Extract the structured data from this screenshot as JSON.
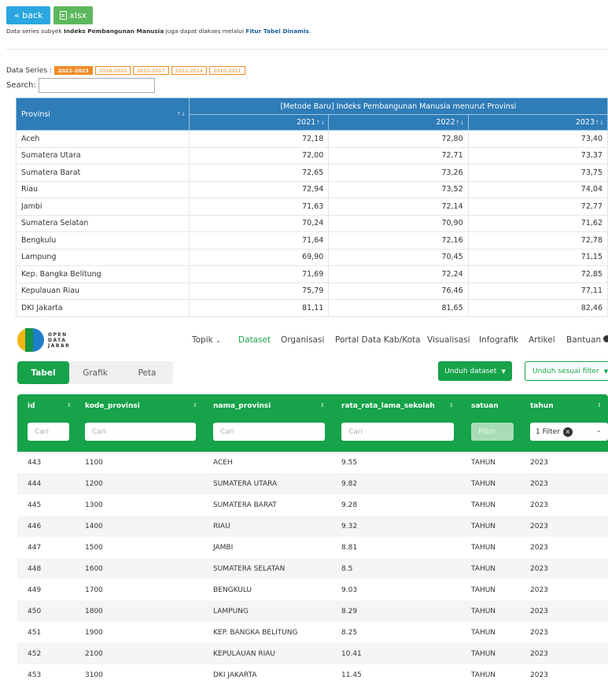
{
  "header": {
    "back_label": "« back",
    "xlsx_label": "xlsx",
    "desc_prefix": "Data series subyek ",
    "desc_subject": "Indeks Pembangunan Manusia",
    "desc_middle": " juga dapat diakses melalui ",
    "desc_link": "Fitur Tabel Dinamis",
    "desc_suffix": "."
  },
  "series": {
    "label": "Data Series :",
    "options": [
      "2021-2023",
      "2018-2020",
      "2015-2017",
      "2012-2014",
      "2010-2011"
    ],
    "active": "2021-2023"
  },
  "search": {
    "label": "Search:",
    "value": ""
  },
  "ipm_table": {
    "col_provinsi": "Provinsi",
    "group_header": "[Metode Baru] Indeks Pembangunan Manusia menurut Provinsi",
    "years": [
      "2021",
      "2022",
      "2023"
    ],
    "rows": [
      {
        "prov": "Aceh",
        "v": [
          "72,18",
          "72,80",
          "73,40"
        ]
      },
      {
        "prov": "Sumatera Utara",
        "v": [
          "72,00",
          "72,71",
          "73,37"
        ]
      },
      {
        "prov": "Sumatera Barat",
        "v": [
          "72,65",
          "73,26",
          "73,75"
        ]
      },
      {
        "prov": "Riau",
        "v": [
          "72,94",
          "73,52",
          "74,04"
        ]
      },
      {
        "prov": "Jambi",
        "v": [
          "71,63",
          "72,14",
          "72,77"
        ]
      },
      {
        "prov": "Sumatera Selatan",
        "v": [
          "70,24",
          "70,90",
          "71,62"
        ]
      },
      {
        "prov": "Bengkulu",
        "v": [
          "71,64",
          "72,16",
          "72,78"
        ]
      },
      {
        "prov": "Lampung",
        "v": [
          "69,90",
          "70,45",
          "71,15"
        ]
      },
      {
        "prov": "Kep. Bangka Belitung",
        "v": [
          "71,69",
          "72,24",
          "72,85"
        ]
      },
      {
        "prov": "Kepulauan Riau",
        "v": [
          "75,79",
          "76,46",
          "77,11"
        ]
      },
      {
        "prov": "DKI Jakarta",
        "v": [
          "81,11",
          "81,65",
          "82,46"
        ]
      }
    ]
  },
  "odj": {
    "logo_lines": [
      "OPEN",
      "DATA",
      "JABAR"
    ],
    "nav": [
      "Topik",
      "Dataset",
      "Organisasi",
      "Portal Data Kab/Kota",
      "Visualisasi",
      "Infografik",
      "Artikel",
      "Bantuan"
    ],
    "nav_active": "Dataset",
    "tabs": [
      "Tabel",
      "Grafik",
      "Peta"
    ],
    "tab_active": "Tabel",
    "btn_unduh": "Unduh dataset",
    "btn_unduh_filter": "Unduh sesuai filter",
    "columns": [
      "id",
      "kode_provinsi",
      "nama_provinsi",
      "rata_rata_lama_sekolah",
      "satuan",
      "tahun"
    ],
    "filter_placeholder": "Cari",
    "filter_satuan_placeholder": "Filter",
    "filter_tahun_value": "1 Filter",
    "rows": [
      [
        "443",
        "1100",
        "ACEH",
        "9.55",
        "TAHUN",
        "2023"
      ],
      [
        "444",
        "1200",
        "SUMATERA UTARA",
        "9.82",
        "TAHUN",
        "2023"
      ],
      [
        "445",
        "1300",
        "SUMATERA BARAT",
        "9.28",
        "TAHUN",
        "2023"
      ],
      [
        "446",
        "1400",
        "RIAU",
        "9.32",
        "TAHUN",
        "2023"
      ],
      [
        "447",
        "1500",
        "JAMBI",
        "8.81",
        "TAHUN",
        "2023"
      ],
      [
        "448",
        "1600",
        "SUMATERA SELATAN",
        "8.5",
        "TAHUN",
        "2023"
      ],
      [
        "449",
        "1700",
        "BENGKULU",
        "9.03",
        "TAHUN",
        "2023"
      ],
      [
        "450",
        "1800",
        "LAMPUNG",
        "8.29",
        "TAHUN",
        "2023"
      ],
      [
        "451",
        "1900",
        "KEP. BANGKA BELITUNG",
        "8.25",
        "TAHUN",
        "2023"
      ],
      [
        "452",
        "2100",
        "KEPULAUAN RIAU",
        "10.41",
        "TAHUN",
        "2023"
      ],
      [
        "453",
        "3100",
        "DKI JAKARTA",
        "11.45",
        "TAHUN",
        "2023"
      ]
    ]
  },
  "colors": {
    "bps_blue": "#2e7cb8",
    "orange": "#f08a24",
    "odj_green": "#16a34a"
  }
}
